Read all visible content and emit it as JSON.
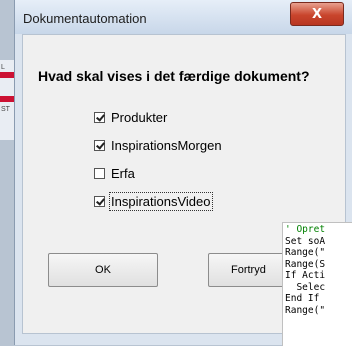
{
  "background": {
    "fragments": [
      "L",
      "ST"
    ]
  },
  "dialog": {
    "title": "Dokumentautomation",
    "close_glyph": "X",
    "question": "Hvad skal vises i det færdige dokument?",
    "options": [
      {
        "label": "Produkter",
        "checked": true
      },
      {
        "label": "InspirationsMorgen",
        "checked": true
      },
      {
        "label": "Erfa",
        "checked": false
      },
      {
        "label": "InspirationsVideo",
        "checked": true,
        "focused": true
      }
    ],
    "ok_label": "OK",
    "cancel_label": "Fortryd"
  },
  "code_editor": {
    "lines": [
      {
        "text": "' Opret",
        "kind": "comment"
      },
      {
        "text": "Set soA",
        "kind": "plain"
      },
      {
        "text": "Range(\"",
        "kind": "plain"
      },
      {
        "text": "Range(S",
        "kind": "plain"
      },
      {
        "text": "If Acti",
        "kind": "plain"
      },
      {
        "text": "  Selec",
        "kind": "plain"
      },
      {
        "text": "End If",
        "kind": "plain"
      },
      {
        "text": "Range(\"",
        "kind": "plain"
      }
    ]
  }
}
